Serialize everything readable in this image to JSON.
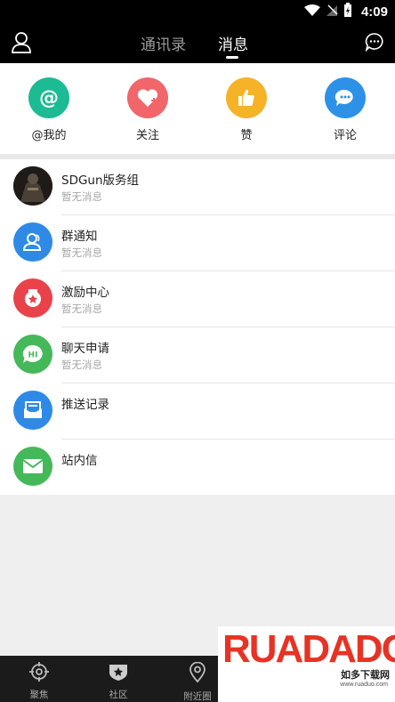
{
  "status_bar": {
    "time": "4:09",
    "icons": [
      "wifi-icon",
      "signal-off-icon",
      "battery-charging-icon"
    ]
  },
  "header": {
    "tabs": [
      {
        "label": "通讯录",
        "active": false
      },
      {
        "label": "消息",
        "active": true
      }
    ],
    "left_icon": "user-icon",
    "right_icon": "chat-bubble-icon"
  },
  "quick_actions": [
    {
      "label": "@我的",
      "icon": "at-icon",
      "color": "#1cbb94"
    },
    {
      "label": "关注",
      "icon": "heart-plus-icon",
      "color": "#f0666a"
    },
    {
      "label": "赞",
      "icon": "thumbs-up-icon",
      "color": "#f6b327"
    },
    {
      "label": "评论",
      "icon": "comment-icon",
      "color": "#2e91e8"
    }
  ],
  "messages": [
    {
      "title": "SDGun版务组",
      "subtitle": "暂无消息",
      "icon": "group-photo-avatar"
    },
    {
      "title": "群通知",
      "subtitle": "暂无消息",
      "icon": "group-notice-icon",
      "color": "#2e8ae6"
    },
    {
      "title": "激励中心",
      "subtitle": "暂无消息",
      "icon": "incentive-icon",
      "color": "#e9424b"
    },
    {
      "title": "聊天申请",
      "subtitle": "暂无消息",
      "icon": "hi-chat-icon",
      "color": "#45b85a"
    },
    {
      "title": "推送记录",
      "subtitle": "",
      "icon": "push-record-icon",
      "color": "#2e8ae6"
    },
    {
      "title": "站内信",
      "subtitle": "",
      "icon": "mail-icon",
      "color": "#45b85a"
    }
  ],
  "bottom_nav": [
    {
      "label": "聚焦",
      "icon": "focus-target-icon"
    },
    {
      "label": "社区",
      "icon": "community-badge-icon"
    },
    {
      "label": "附近圈",
      "icon": "location-pin-icon"
    }
  ],
  "watermark": {
    "brand": "RUADADO",
    "cn_text": "如多下载网",
    "url": "www.ruaduo.com"
  }
}
